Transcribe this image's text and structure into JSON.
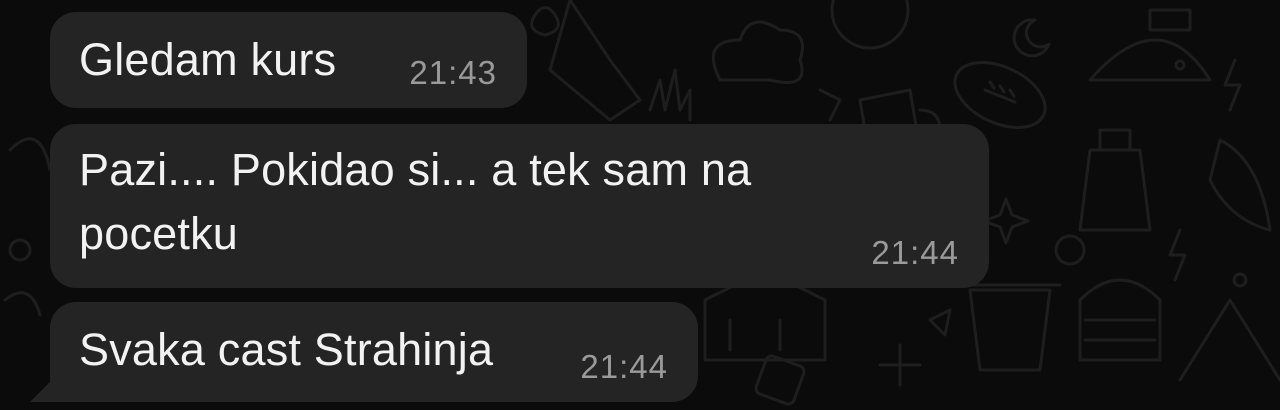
{
  "messages": [
    {
      "text": "Gledam kurs",
      "time": "21:43"
    },
    {
      "text": "Pazi.... Pokidao si... a tek sam na\npocetku",
      "time": "21:44"
    },
    {
      "text": "Svaka cast Strahinja",
      "time": "21:44"
    }
  ],
  "colors": {
    "background": "#0b0b0b",
    "bubble": "#242424",
    "text": "#f2f2f2",
    "timestamp": "#9a9a9a",
    "doodle": "#1f1f1f"
  }
}
